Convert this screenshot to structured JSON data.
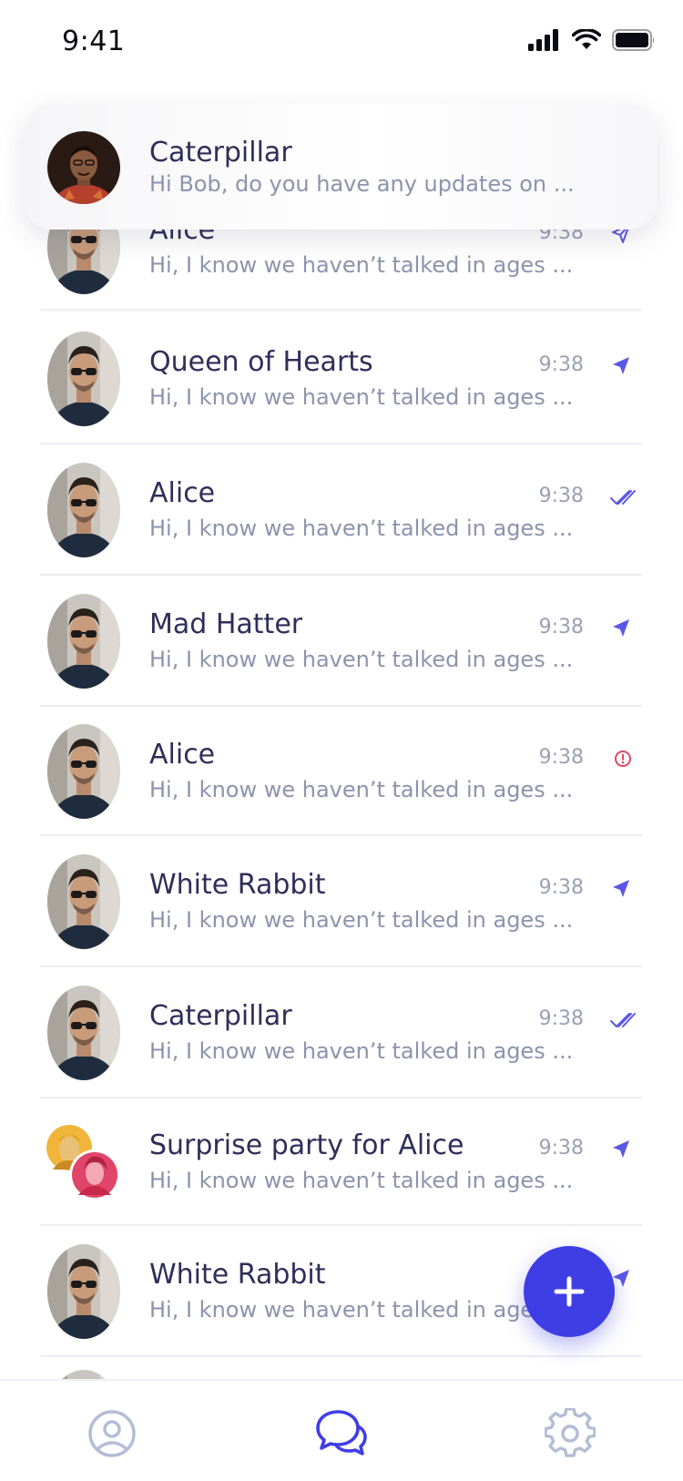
{
  "status_bar": {
    "time": "9:41"
  },
  "notification": {
    "name": "Caterpillar",
    "preview": "Hi Bob, do you have any updates on ..."
  },
  "conversations": [
    {
      "name": "Alice",
      "preview": "Hi, I know we haven’t talked in ages ...",
      "time": "9:38",
      "status": "sent-outline"
    },
    {
      "name": "Queen of Hearts",
      "preview": "Hi, I know we haven’t talked in ages ...",
      "time": "9:38",
      "status": "sent"
    },
    {
      "name": "Alice",
      "preview": "Hi, I know we haven’t talked in ages ...",
      "time": "9:38",
      "status": "read"
    },
    {
      "name": "Mad Hatter",
      "preview": "Hi, I know we haven’t talked in ages ...",
      "time": "9:38",
      "status": "sent"
    },
    {
      "name": "Alice",
      "preview": "Hi, I know we haven’t talked in ages ...",
      "time": "9:38",
      "status": "error"
    },
    {
      "name": "White Rabbit",
      "preview": "Hi, I know we haven’t talked in ages ...",
      "time": "9:38",
      "status": "sent"
    },
    {
      "name": "Caterpillar",
      "preview": "Hi, I know we haven’t talked in ages ...",
      "time": "9:38",
      "status": "read"
    },
    {
      "name": "Surprise party for Alice",
      "preview": "Hi, I know we haven’t talked in ages ...",
      "time": "9:38",
      "status": "sent"
    },
    {
      "name": "White Rabbit",
      "preview": "Hi, I know we haven’t talked in ages ...",
      "time": "",
      "status": "sent"
    }
  ],
  "tabbar": {
    "items": [
      {
        "icon": "profile-icon",
        "active": false
      },
      {
        "icon": "chats-icon",
        "active": true
      },
      {
        "icon": "settings-icon",
        "active": false
      }
    ]
  },
  "fab": {
    "icon": "plus-icon"
  },
  "colors": {
    "accent": "#3f3ee5",
    "sent_icon": "#5b57e6",
    "error": "#e0485e",
    "name_text": "#2f2e5a",
    "preview_text": "#8c93ad",
    "time_text": "#9aa0b5",
    "inactive_icon": "#b3bdd6"
  }
}
